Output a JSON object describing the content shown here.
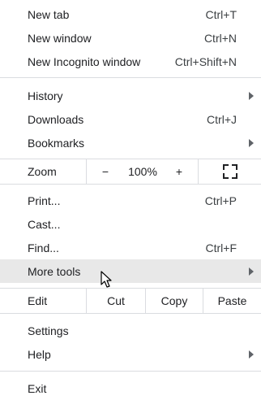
{
  "group1": [
    {
      "label": "New tab",
      "shortcut": "Ctrl+T"
    },
    {
      "label": "New window",
      "shortcut": "Ctrl+N"
    },
    {
      "label": "New Incognito window",
      "shortcut": "Ctrl+Shift+N"
    }
  ],
  "group2": [
    {
      "label": "History",
      "submenu": true
    },
    {
      "label": "Downloads",
      "shortcut": "Ctrl+J"
    },
    {
      "label": "Bookmarks",
      "submenu": true
    }
  ],
  "zoom": {
    "label": "Zoom",
    "minus": "−",
    "level": "100%",
    "plus": "+",
    "fullscreen_icon": "fullscreen-icon"
  },
  "group3": [
    {
      "label": "Print...",
      "shortcut": "Ctrl+P"
    },
    {
      "label": "Cast..."
    },
    {
      "label": "Find...",
      "shortcut": "Ctrl+F"
    },
    {
      "label": "More tools",
      "submenu": true,
      "highlighted": true
    }
  ],
  "edit": {
    "label": "Edit",
    "cut": "Cut",
    "copy": "Copy",
    "paste": "Paste"
  },
  "group4": [
    {
      "label": "Settings"
    },
    {
      "label": "Help",
      "submenu": true
    }
  ],
  "group5": [
    {
      "label": "Exit"
    }
  ],
  "colors": {
    "highlight": "#e8e8e8",
    "separator": "#dadce0",
    "text": "#202124"
  }
}
